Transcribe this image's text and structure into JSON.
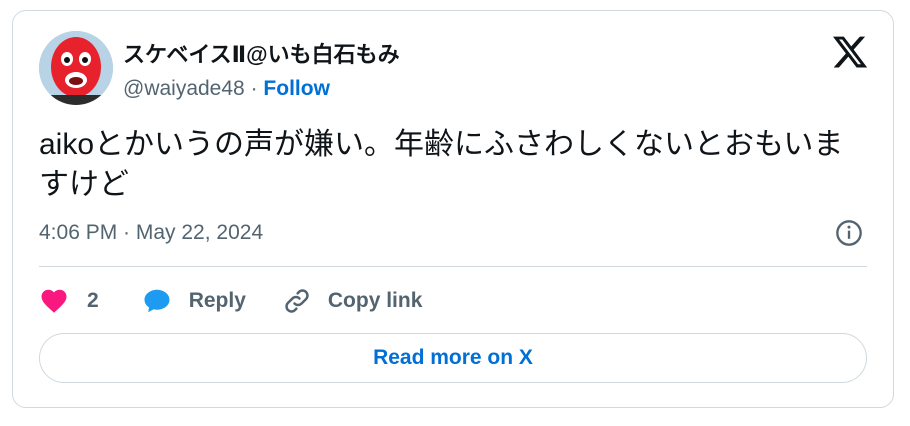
{
  "author": {
    "display_name": "スケベイスⅡ@いも白石もみ",
    "handle": "@waiyade48",
    "separator": "·",
    "follow_label": "Follow"
  },
  "tweet": {
    "text": "aikoとかいうの声が嫌い。年齢にふさわしくないとおもいますけど",
    "timestamp": "4:06 PM · May 22, 2024"
  },
  "actions": {
    "like_count": "2",
    "reply_label": "Reply",
    "copy_link_label": "Copy link"
  },
  "read_more_label": "Read more on X",
  "icons": {
    "brand": "x-logo-icon",
    "info": "info-icon",
    "like": "heart-icon",
    "reply": "speech-bubble-icon",
    "copy": "link-icon"
  },
  "colors": {
    "link_blue": "#006fd6",
    "heart": "#f91880",
    "reply_bubble": "#1d9bf0",
    "text_primary": "#0f1419",
    "text_secondary": "#536471",
    "border": "#cfd9de"
  }
}
